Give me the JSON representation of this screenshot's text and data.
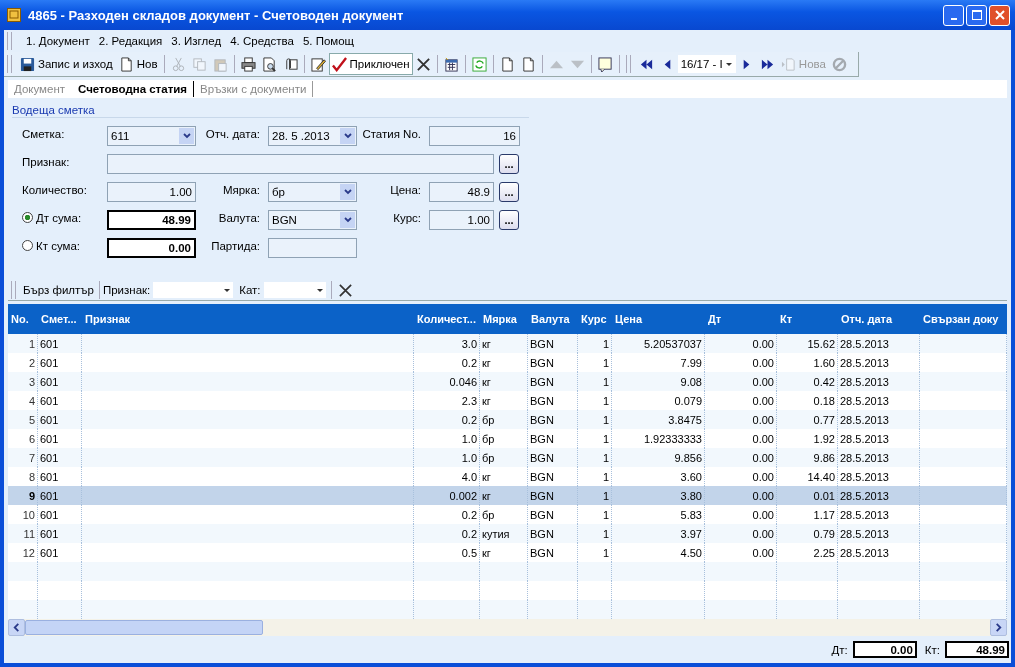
{
  "window": {
    "title": "4865 - Разходен складов документ - Счетоводен документ"
  },
  "menu": [
    {
      "label": "1. Документ"
    },
    {
      "label": "2. Редакция"
    },
    {
      "label": "3. Изглед"
    },
    {
      "label": "4. Средства"
    },
    {
      "label": "5. Помощ"
    }
  ],
  "toolbar": [
    {
      "kind": "button",
      "label": "Запис и изход",
      "disabled": false,
      "pressed": false
    },
    {
      "kind": "button",
      "label": "Нов",
      "disabled": false,
      "pressed": false
    },
    {
      "kind": "separator"
    },
    {
      "kind": "button",
      "disabled": true,
      "pressed": false
    },
    {
      "kind": "button",
      "disabled": true,
      "pressed": false
    },
    {
      "kind": "button",
      "disabled": true,
      "pressed": false
    },
    {
      "kind": "separator"
    },
    {
      "kind": "button",
      "disabled": false,
      "pressed": false
    },
    {
      "kind": "button",
      "disabled": false,
      "pressed": false
    },
    {
      "kind": "button",
      "disabled": false,
      "pressed": false
    },
    {
      "kind": "separator"
    },
    {
      "kind": "button",
      "disabled": false,
      "pressed": false
    },
    {
      "kind": "button",
      "label": "Приключен",
      "disabled": false,
      "pressed": true
    },
    {
      "kind": "button",
      "disabled": false,
      "pressed": false
    },
    {
      "kind": "separator"
    },
    {
      "kind": "button",
      "disabled": false,
      "pressed": false
    },
    {
      "kind": "separator"
    },
    {
      "kind": "button",
      "disabled": false,
      "pressed": false
    },
    {
      "kind": "separator"
    },
    {
      "kind": "button",
      "disabled": false,
      "pressed": false
    },
    {
      "kind": "button",
      "disabled": false,
      "pressed": false
    },
    {
      "kind": "separator"
    },
    {
      "kind": "button",
      "disabled": true,
      "pressed": false
    },
    {
      "kind": "button",
      "disabled": true,
      "pressed": false
    },
    {
      "kind": "separator"
    },
    {
      "kind": "button",
      "disabled": false,
      "pressed": false
    }
  ],
  "navigator": {
    "record": "16/17 - I",
    "new": {
      "label": "Нова",
      "disabled": true
    },
    "cancel": {
      "disabled": true
    }
  },
  "tabs": [
    {
      "label": "Документ",
      "selected": false
    },
    {
      "label": "Счетоводна статия",
      "selected": true
    },
    {
      "label": "Връзки с документи",
      "selected": false
    }
  ],
  "form": {
    "section_title": "Водеща сметка",
    "account": {
      "label": "Сметка:",
      "value": "611"
    },
    "report_date": {
      "label": "Отч. дата:",
      "value": "28. 5 .2013"
    },
    "entry_no": {
      "label": "Статия No.",
      "value": "16"
    },
    "attribute": {
      "label": "Признак:",
      "button": "..."
    },
    "quantity": {
      "label": "Количество:",
      "value": "1.00"
    },
    "unit": {
      "label": "Мярка:",
      "value": "бр"
    },
    "price": {
      "label": "Цена:",
      "value": "48.9",
      "button": "..."
    },
    "debit": {
      "label": "Дт сума:",
      "value": "48.99",
      "selected": true
    },
    "currency": {
      "label": "Валута:",
      "value": "BGN"
    },
    "rate": {
      "label": "Курс:",
      "value": "1.00",
      "button": "..."
    },
    "credit": {
      "label": "Кт сума:",
      "value": "0.00",
      "selected": false
    },
    "batch": {
      "label": "Партида:"
    }
  },
  "filter": {
    "button": "Бърз филтър",
    "attribute_label": "Признак:",
    "category_label": "Кат:"
  },
  "table": {
    "columns": [
      "No.",
      "Смет...",
      "Признак",
      "Количест...",
      "Мярка",
      "Валута",
      "Курс",
      "Цена",
      "Дт",
      "Кт",
      "Отч. дата",
      "Свързан доку"
    ],
    "rows": [
      {
        "no": "1",
        "account": "601",
        "quantity": "3.0",
        "unit": "кг",
        "currency": "BGN",
        "rate": "1",
        "price": "5.20537037",
        "debit": "0.00",
        "credit": "15.62",
        "date": "28.5.2013",
        "selected": false
      },
      {
        "no": "2",
        "account": "601",
        "quantity": "0.2",
        "unit": "кг",
        "currency": "BGN",
        "rate": "1",
        "price": "7.99",
        "debit": "0.00",
        "credit": "1.60",
        "date": "28.5.2013",
        "selected": false
      },
      {
        "no": "3",
        "account": "601",
        "quantity": "0.046",
        "unit": "кг",
        "currency": "BGN",
        "rate": "1",
        "price": "9.08",
        "debit": "0.00",
        "credit": "0.42",
        "date": "28.5.2013",
        "selected": false
      },
      {
        "no": "4",
        "account": "601",
        "quantity": "2.3",
        "unit": "кг",
        "currency": "BGN",
        "rate": "1",
        "price": "0.079",
        "debit": "0.00",
        "credit": "0.18",
        "date": "28.5.2013",
        "selected": false
      },
      {
        "no": "5",
        "account": "601",
        "quantity": "0.2",
        "unit": "бр",
        "currency": "BGN",
        "rate": "1",
        "price": "3.8475",
        "debit": "0.00",
        "credit": "0.77",
        "date": "28.5.2013",
        "selected": false
      },
      {
        "no": "6",
        "account": "601",
        "quantity": "1.0",
        "unit": "бр",
        "currency": "BGN",
        "rate": "1",
        "price": "1.92333333",
        "debit": "0.00",
        "credit": "1.92",
        "date": "28.5.2013",
        "selected": false
      },
      {
        "no": "7",
        "account": "601",
        "quantity": "1.0",
        "unit": "бр",
        "currency": "BGN",
        "rate": "1",
        "price": "9.856",
        "debit": "0.00",
        "credit": "9.86",
        "date": "28.5.2013",
        "selected": false
      },
      {
        "no": "8",
        "account": "601",
        "quantity": "4.0",
        "unit": "кг",
        "currency": "BGN",
        "rate": "1",
        "price": "3.60",
        "debit": "0.00",
        "credit": "14.40",
        "date": "28.5.2013",
        "selected": false
      },
      {
        "no": "9",
        "account": "601",
        "quantity": "0.002",
        "unit": "кг",
        "currency": "BGN",
        "rate": "1",
        "price": "3.80",
        "debit": "0.00",
        "credit": "0.01",
        "date": "28.5.2013",
        "selected": true
      },
      {
        "no": "10",
        "account": "601",
        "quantity": "0.2",
        "unit": "бр",
        "currency": "BGN",
        "rate": "1",
        "price": "5.83",
        "debit": "0.00",
        "credit": "1.17",
        "date": "28.5.2013",
        "selected": false
      },
      {
        "no": "11",
        "account": "601",
        "quantity": "0.2",
        "unit": "кутия",
        "currency": "BGN",
        "rate": "1",
        "price": "3.97",
        "debit": "0.00",
        "credit": "0.79",
        "date": "28.5.2013",
        "selected": false
      },
      {
        "no": "12",
        "account": "601",
        "quantity": "0.5",
        "unit": "кг",
        "currency": "BGN",
        "rate": "1",
        "price": "4.50",
        "debit": "0.00",
        "credit": "2.25",
        "date": "28.5.2013",
        "selected": false
      }
    ]
  },
  "totals": {
    "debit_label": "Дт:",
    "debit": "0.00",
    "credit_label": "Кт:",
    "credit": "48.99"
  }
}
